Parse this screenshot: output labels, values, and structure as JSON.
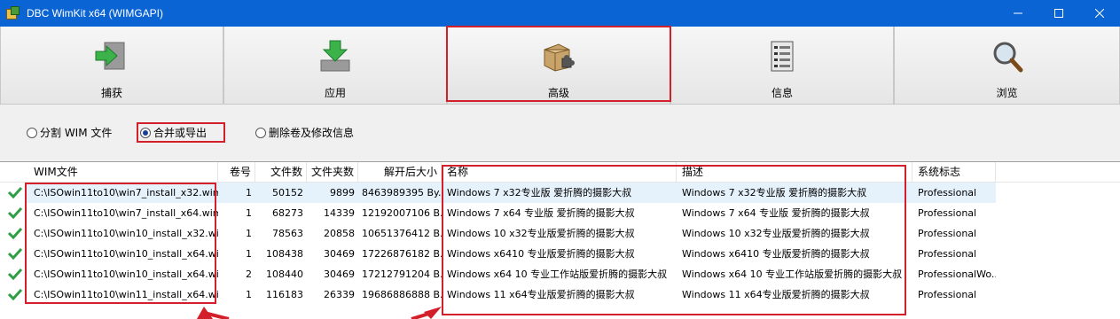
{
  "window": {
    "title": "DBC WimKit x64 (WIMGAPI)"
  },
  "toolbar": {
    "buttons": [
      {
        "label": "捕获",
        "icon": "capture-icon"
      },
      {
        "label": "应用",
        "icon": "apply-icon"
      },
      {
        "label": "高级",
        "icon": "advanced-icon"
      },
      {
        "label": "信息",
        "icon": "info-icon"
      },
      {
        "label": "浏览",
        "icon": "browse-icon"
      }
    ],
    "active": "高级"
  },
  "options": [
    {
      "label": "分割 WIM 文件",
      "checked": false
    },
    {
      "label": "合并或导出",
      "checked": true
    },
    {
      "label": "删除卷及修改信息",
      "checked": false
    }
  ],
  "table": {
    "columns": [
      "WIM文件",
      "卷号",
      "文件数",
      "文件夹数",
      "解开后大小",
      "名称",
      "描述",
      "系统标志"
    ],
    "rows": [
      [
        "C:\\ISOwin11to10\\win7_install_x32.wim",
        "1",
        "50152",
        "9899",
        "8463989395 By...",
        "Windows 7 x32专业版 爱折腾的摄影大叔",
        "Windows 7 x32专业版 爱折腾的摄影大叔",
        "Professional"
      ],
      [
        "C:\\ISOwin11to10\\win7_install_x64.wim",
        "1",
        "68273",
        "14339",
        "12192007106 B...",
        "Windows 7 x64 专业版  爱折腾的摄影大叔",
        "Windows 7 x64 专业版  爱折腾的摄影大叔",
        "Professional"
      ],
      [
        "C:\\ISOwin11to10\\win10_install_x32.wim",
        "1",
        "78563",
        "20858",
        "10651376412 B...",
        "Windows 10 x32专业版爱折腾的摄影大叔",
        "Windows 10 x32专业版爱折腾的摄影大叔",
        "Professional"
      ],
      [
        "C:\\ISOwin11to10\\win10_install_x64.wim",
        "1",
        "108438",
        "30469",
        "17226876182 B...",
        "Windows x6410 专业版爱折腾的摄影大叔",
        "Windows x6410 专业版爱折腾的摄影大叔",
        "Professional"
      ],
      [
        "C:\\ISOwin11to10\\win10_install_x64.wim",
        "2",
        "108440",
        "30469",
        "17212791204 B...",
        "Windows x64 10 专业工作站版爱折腾的摄影大叔",
        "Windows x64 10 专业工作站版爱折腾的摄影大叔",
        "ProfessionalWo..."
      ],
      [
        "C:\\ISOwin11to10\\win11_install_x64.wim",
        "1",
        "116183",
        "26339",
        "19686886888 B...",
        "Windows 11 x64专业版爱折腾的摄影大叔",
        "Windows 11 x64专业版爱折腾的摄影大叔",
        "Professional"
      ]
    ]
  },
  "colors": {
    "titlebar": "#0a64d4",
    "highlight": "#d21f2a",
    "selected_row": "#e5f1fb",
    "check": "#2f9e44"
  }
}
